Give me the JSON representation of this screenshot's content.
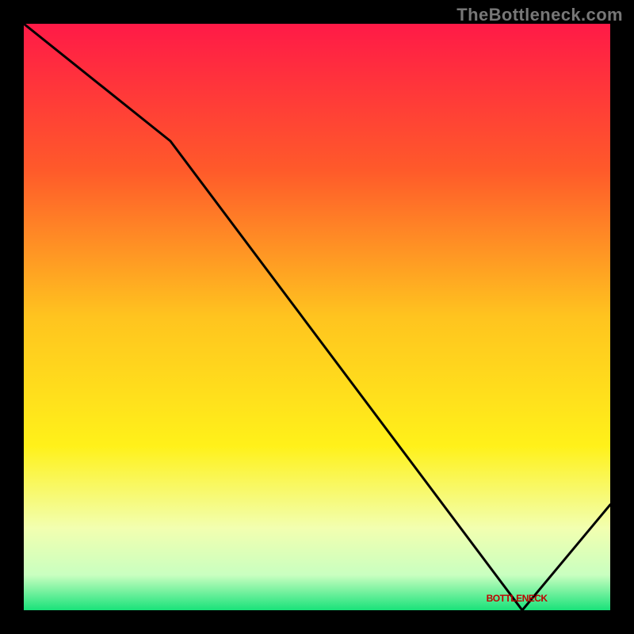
{
  "watermark": "TheBottleneck.com",
  "bottom_label": "BOTTLENECK",
  "chart_data": {
    "type": "line",
    "title": "",
    "xlabel": "",
    "ylabel": "",
    "x": [
      0,
      25,
      85,
      100
    ],
    "values": [
      100,
      80,
      0,
      18
    ],
    "ylim": [
      0,
      100
    ],
    "xlim": [
      0,
      100
    ],
    "minimum_band_x": [
      78,
      90
    ],
    "gradient_stops": [
      {
        "offset": 0.0,
        "color": "#ff1a47"
      },
      {
        "offset": 0.25,
        "color": "#ff5a2a"
      },
      {
        "offset": 0.5,
        "color": "#ffc41f"
      },
      {
        "offset": 0.72,
        "color": "#fff11a"
      },
      {
        "offset": 0.86,
        "color": "#f2ffb0"
      },
      {
        "offset": 0.94,
        "color": "#c9ffc0"
      },
      {
        "offset": 1.0,
        "color": "#19e27a"
      }
    ]
  }
}
